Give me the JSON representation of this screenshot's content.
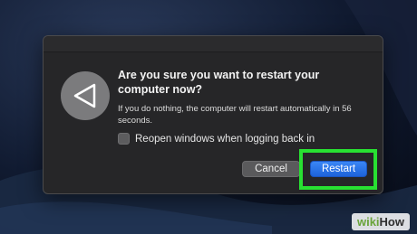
{
  "dialog": {
    "title": "Are you sure you want to restart your computer now?",
    "message": "If you do nothing, the computer will restart automatically in 56 seconds.",
    "checkbox": {
      "label": "Reopen windows when logging back in",
      "checked": false
    },
    "buttons": {
      "cancel": "Cancel",
      "restart": "Restart"
    },
    "icon": "restart-icon"
  },
  "highlight_color": "#28e032",
  "watermark": {
    "part1": "wiki",
    "part2": "How"
  }
}
